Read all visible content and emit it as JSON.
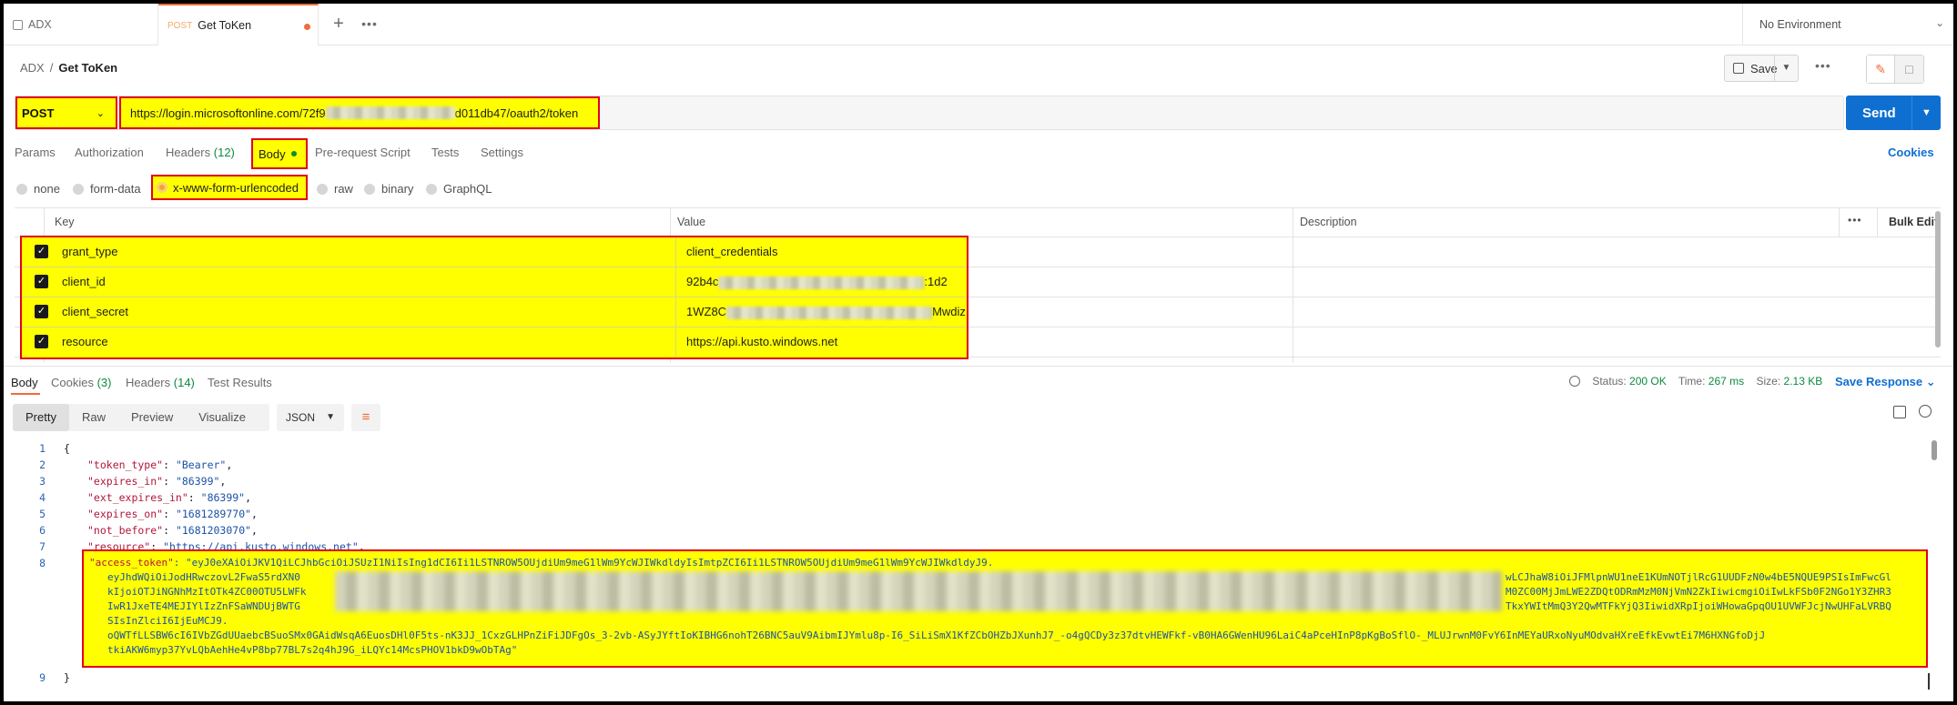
{
  "tabs": {
    "tab1_label": "ADX",
    "tab2_method": "POST",
    "tab2_label": "Get ToKen",
    "new_tab": "+",
    "more": "•••"
  },
  "environment": {
    "label": "No Environment"
  },
  "breadcrumb": {
    "collection": "ADX",
    "separator": "/",
    "current": "Get ToKen"
  },
  "toolbar": {
    "save_label": "Save",
    "more": "•••"
  },
  "request": {
    "method": "POST",
    "url_prefix": "https://login.microsoftonline.com/72f9",
    "url_suffix": "d011db47/oauth2/token",
    "send_label": "Send"
  },
  "request_tabs": {
    "params": "Params",
    "authorization": "Authorization",
    "headers": "Headers",
    "headers_count": "(12)",
    "body": "Body",
    "prerequest": "Pre-request Script",
    "tests": "Tests",
    "settings": "Settings",
    "cookies": "Cookies"
  },
  "body_types": {
    "none": "none",
    "form_data": "form-data",
    "urlencoded": "x-www-form-urlencoded",
    "raw": "raw",
    "binary": "binary",
    "graphql": "GraphQL"
  },
  "params_table": {
    "headers": {
      "key": "Key",
      "value": "Value",
      "description": "Description",
      "bulk_edit": "Bulk Edit",
      "more": "•••"
    },
    "rows": [
      {
        "key": "grant_type",
        "value_prefix": "client_credentials",
        "value_suffix": ""
      },
      {
        "key": "client_id",
        "value_prefix": "92b4c",
        "value_suffix": ":1d2"
      },
      {
        "key": "client_secret",
        "value_prefix": "1WZ8C",
        "value_suffix": "Mwdiz"
      },
      {
        "key": "resource",
        "value_prefix": "https://api.kusto.windows.net",
        "value_suffix": ""
      }
    ]
  },
  "response_tabs": {
    "body": "Body",
    "cookies": "Cookies",
    "cookies_count": "(3)",
    "headers": "Headers",
    "headers_count": "(14)",
    "test_results": "Test Results"
  },
  "response_status": {
    "status_label": "Status:",
    "status_value": "200 OK",
    "time_label": "Time:",
    "time_value": "267 ms",
    "size_label": "Size:",
    "size_value": "2.13 KB",
    "save_response": "Save Response"
  },
  "view_modes": {
    "pretty": "Pretty",
    "raw": "Raw",
    "preview": "Preview",
    "visualize": "Visualize",
    "format": "JSON"
  },
  "response_body": {
    "line_numbers": [
      "1",
      "2",
      "3",
      "4",
      "5",
      "6",
      "7",
      "8",
      "9"
    ],
    "open_brace": "{",
    "fields": [
      {
        "key": "\"token_type\"",
        "value": "\"Bearer\""
      },
      {
        "key": "\"expires_in\"",
        "value": "\"86399\""
      },
      {
        "key": "\"ext_expires_in\"",
        "value": "\"86399\""
      },
      {
        "key": "\"expires_on\"",
        "value": "\"1681289770\""
      },
      {
        "key": "\"not_before\"",
        "value": "\"1681203070\""
      },
      {
        "key": "\"resource\"",
        "value": "\"https://api.kusto.windows.net\""
      }
    ],
    "access_token_key": "\"access_token\"",
    "token_line1": "\"eyJ0eXAiOiJKV1QiLCJhbGciOiJSUzI1NiIsIng1dCI6Ii1LSTNROW5OUjdiUm9meG1lWm9YcWJIWkdldyIsImtpZCI6Ii1LSTNROW5OUjdiUm9meG1lWm9YcWJIWkdldyJ9.",
    "token_line2_start": "eyJhdWQiOiJodHRwczovL2FwaS5rdXN0",
    "token_line2_end": "wLCJhaW8iOiJFMlpnWU1neE1KUmNOTjlRcG1UUDFzN0w4bE5NQUE9PSIsImFwcGl",
    "token_line3_start": "kIjoiOTJiNGNhMzItOTk4ZC00OTU5LWFk",
    "token_line3_end": "M0ZC00MjJmLWE2ZDQtODRmMzM0NjVmN2ZkIiwicmgiOiIwLkFSb0F2NGo1Y3ZHR3",
    "token_line4_start": "IwR1JxeTE4MEJIYlIzZnFSaWNDUjBWTG",
    "token_line4_end": "TkxYWItMmQ3Y2QwMTFkYjQ3IiwidXRpIjoiWHowaGpqOU1UVWFJcjNwUHFaLVRBQ",
    "token_line5": "SIsInZlciI6IjEuMCJ9.",
    "token_line6": "oQWTfLLSBW6cI6IVbZGdUUaebcBSuoSMx0GAidWsqA6EuosDHl0F5ts-nK3JJ_1CxzGLHPnZiFiJDFgOs_3-2vb-ASyJYftIoKIBHG6nohT26BNC5auV9AibmIJYmlu8p-I6_SiLiSmX1KfZCbOHZbJXunhJ7_-o4gQCDy3z37dtvHEWFkf-vB0HA6GWenHU96LaiC4aPceHInP8pKgBoSflO-_MLUJrwnM0FvY6InMEYaURxoNyuMOdvaHXreEfkEvwtEi7M6HXNGfoDjJ",
    "token_line7": "tkiAKW6myp37YvLQbAehHe4vP8bp77BL7s2q4hJ9G_iLQYc14McsPHOV1bkD9wObTAg\"",
    "close_brace": "}"
  }
}
